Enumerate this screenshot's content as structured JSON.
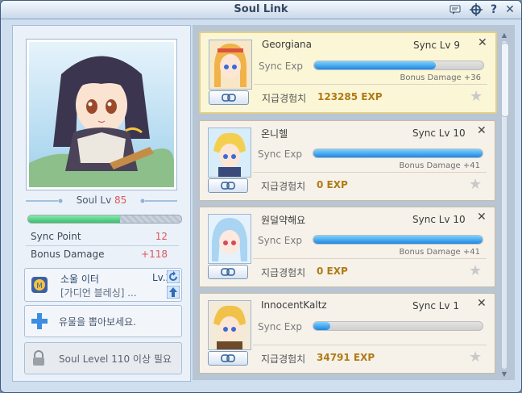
{
  "window": {
    "title": "Soul Link"
  },
  "profile": {
    "soul_lv_label": "Soul Lv",
    "soul_lv_value": "85",
    "progress": 0.6,
    "stats": [
      {
        "label": "Sync Point",
        "value": "12"
      },
      {
        "label": "Bonus Damage",
        "value": "+118"
      }
    ]
  },
  "panels": {
    "ether": {
      "title": "소울 이터",
      "level": "Lv.2",
      "subtitle": "[가디언 블레싱] ..."
    },
    "draw": {
      "text": "유물을 뽑아보세요."
    },
    "locked": {
      "text": "Soul Level 110 이상 필요"
    }
  },
  "list": {
    "sync_exp_label": "Sync Exp",
    "exp_label": "지급경험치",
    "items": [
      {
        "name": "Georgiana",
        "sync_lv": "Sync Lv 9",
        "progress": 0.72,
        "bonus": "Bonus Damage +36",
        "exp": "123285 EXP",
        "selected": true
      },
      {
        "name": "온니헬",
        "sync_lv": "Sync Lv 10",
        "progress": 1.0,
        "bonus": "Bonus Damage +41",
        "exp": "0 EXP",
        "selected": false
      },
      {
        "name": "원덜약해요",
        "sync_lv": "Sync Lv 10",
        "progress": 1.0,
        "bonus": "Bonus Damage +41",
        "exp": "0 EXP",
        "selected": false
      },
      {
        "name": "InnocentKaltz",
        "sync_lv": "Sync Lv 1",
        "progress": 0.1,
        "bonus": "",
        "exp": "34791 EXP",
        "selected": false
      }
    ]
  },
  "colors": {
    "accent": "#e0565a",
    "exp": "#b07a16",
    "xp_fill": "#1d86e0"
  }
}
